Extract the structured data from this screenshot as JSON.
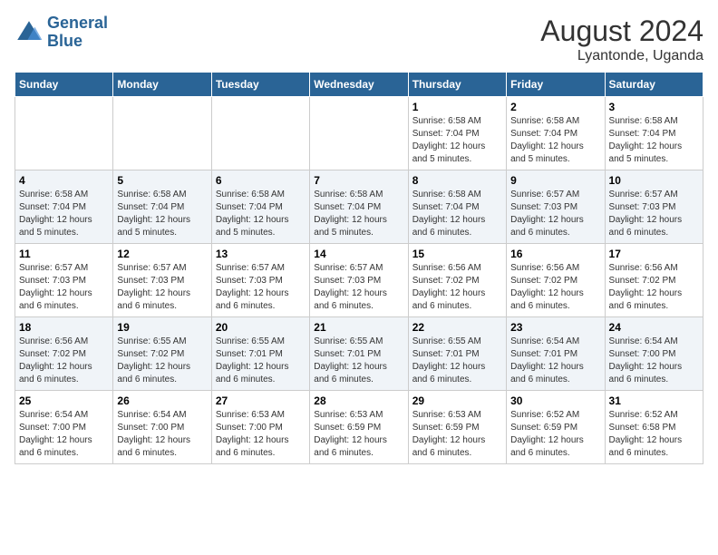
{
  "header": {
    "logo_line1": "General",
    "logo_line2": "Blue",
    "month_year": "August 2024",
    "location": "Lyantonde, Uganda"
  },
  "weekdays": [
    "Sunday",
    "Monday",
    "Tuesday",
    "Wednesday",
    "Thursday",
    "Friday",
    "Saturday"
  ],
  "weeks": [
    {
      "row_class": "row-odd",
      "days": [
        {
          "num": "",
          "info": "",
          "empty": true
        },
        {
          "num": "",
          "info": "",
          "empty": true
        },
        {
          "num": "",
          "info": "",
          "empty": true
        },
        {
          "num": "",
          "info": "",
          "empty": true
        },
        {
          "num": "1",
          "info": "Sunrise: 6:58 AM\nSunset: 7:04 PM\nDaylight: 12 hours\nand 5 minutes."
        },
        {
          "num": "2",
          "info": "Sunrise: 6:58 AM\nSunset: 7:04 PM\nDaylight: 12 hours\nand 5 minutes."
        },
        {
          "num": "3",
          "info": "Sunrise: 6:58 AM\nSunset: 7:04 PM\nDaylight: 12 hours\nand 5 minutes."
        }
      ]
    },
    {
      "row_class": "row-even",
      "days": [
        {
          "num": "4",
          "info": "Sunrise: 6:58 AM\nSunset: 7:04 PM\nDaylight: 12 hours\nand 5 minutes."
        },
        {
          "num": "5",
          "info": "Sunrise: 6:58 AM\nSunset: 7:04 PM\nDaylight: 12 hours\nand 5 minutes."
        },
        {
          "num": "6",
          "info": "Sunrise: 6:58 AM\nSunset: 7:04 PM\nDaylight: 12 hours\nand 5 minutes."
        },
        {
          "num": "7",
          "info": "Sunrise: 6:58 AM\nSunset: 7:04 PM\nDaylight: 12 hours\nand 5 minutes."
        },
        {
          "num": "8",
          "info": "Sunrise: 6:58 AM\nSunset: 7:04 PM\nDaylight: 12 hours\nand 6 minutes."
        },
        {
          "num": "9",
          "info": "Sunrise: 6:57 AM\nSunset: 7:03 PM\nDaylight: 12 hours\nand 6 minutes."
        },
        {
          "num": "10",
          "info": "Sunrise: 6:57 AM\nSunset: 7:03 PM\nDaylight: 12 hours\nand 6 minutes."
        }
      ]
    },
    {
      "row_class": "row-odd",
      "days": [
        {
          "num": "11",
          "info": "Sunrise: 6:57 AM\nSunset: 7:03 PM\nDaylight: 12 hours\nand 6 minutes."
        },
        {
          "num": "12",
          "info": "Sunrise: 6:57 AM\nSunset: 7:03 PM\nDaylight: 12 hours\nand 6 minutes."
        },
        {
          "num": "13",
          "info": "Sunrise: 6:57 AM\nSunset: 7:03 PM\nDaylight: 12 hours\nand 6 minutes."
        },
        {
          "num": "14",
          "info": "Sunrise: 6:57 AM\nSunset: 7:03 PM\nDaylight: 12 hours\nand 6 minutes."
        },
        {
          "num": "15",
          "info": "Sunrise: 6:56 AM\nSunset: 7:02 PM\nDaylight: 12 hours\nand 6 minutes."
        },
        {
          "num": "16",
          "info": "Sunrise: 6:56 AM\nSunset: 7:02 PM\nDaylight: 12 hours\nand 6 minutes."
        },
        {
          "num": "17",
          "info": "Sunrise: 6:56 AM\nSunset: 7:02 PM\nDaylight: 12 hours\nand 6 minutes."
        }
      ]
    },
    {
      "row_class": "row-even",
      "days": [
        {
          "num": "18",
          "info": "Sunrise: 6:56 AM\nSunset: 7:02 PM\nDaylight: 12 hours\nand 6 minutes."
        },
        {
          "num": "19",
          "info": "Sunrise: 6:55 AM\nSunset: 7:02 PM\nDaylight: 12 hours\nand 6 minutes."
        },
        {
          "num": "20",
          "info": "Sunrise: 6:55 AM\nSunset: 7:01 PM\nDaylight: 12 hours\nand 6 minutes."
        },
        {
          "num": "21",
          "info": "Sunrise: 6:55 AM\nSunset: 7:01 PM\nDaylight: 12 hours\nand 6 minutes."
        },
        {
          "num": "22",
          "info": "Sunrise: 6:55 AM\nSunset: 7:01 PM\nDaylight: 12 hours\nand 6 minutes."
        },
        {
          "num": "23",
          "info": "Sunrise: 6:54 AM\nSunset: 7:01 PM\nDaylight: 12 hours\nand 6 minutes."
        },
        {
          "num": "24",
          "info": "Sunrise: 6:54 AM\nSunset: 7:00 PM\nDaylight: 12 hours\nand 6 minutes."
        }
      ]
    },
    {
      "row_class": "row-odd",
      "days": [
        {
          "num": "25",
          "info": "Sunrise: 6:54 AM\nSunset: 7:00 PM\nDaylight: 12 hours\nand 6 minutes."
        },
        {
          "num": "26",
          "info": "Sunrise: 6:54 AM\nSunset: 7:00 PM\nDaylight: 12 hours\nand 6 minutes."
        },
        {
          "num": "27",
          "info": "Sunrise: 6:53 AM\nSunset: 7:00 PM\nDaylight: 12 hours\nand 6 minutes."
        },
        {
          "num": "28",
          "info": "Sunrise: 6:53 AM\nSunset: 6:59 PM\nDaylight: 12 hours\nand 6 minutes."
        },
        {
          "num": "29",
          "info": "Sunrise: 6:53 AM\nSunset: 6:59 PM\nDaylight: 12 hours\nand 6 minutes."
        },
        {
          "num": "30",
          "info": "Sunrise: 6:52 AM\nSunset: 6:59 PM\nDaylight: 12 hours\nand 6 minutes."
        },
        {
          "num": "31",
          "info": "Sunrise: 6:52 AM\nSunset: 6:58 PM\nDaylight: 12 hours\nand 6 minutes."
        }
      ]
    }
  ]
}
